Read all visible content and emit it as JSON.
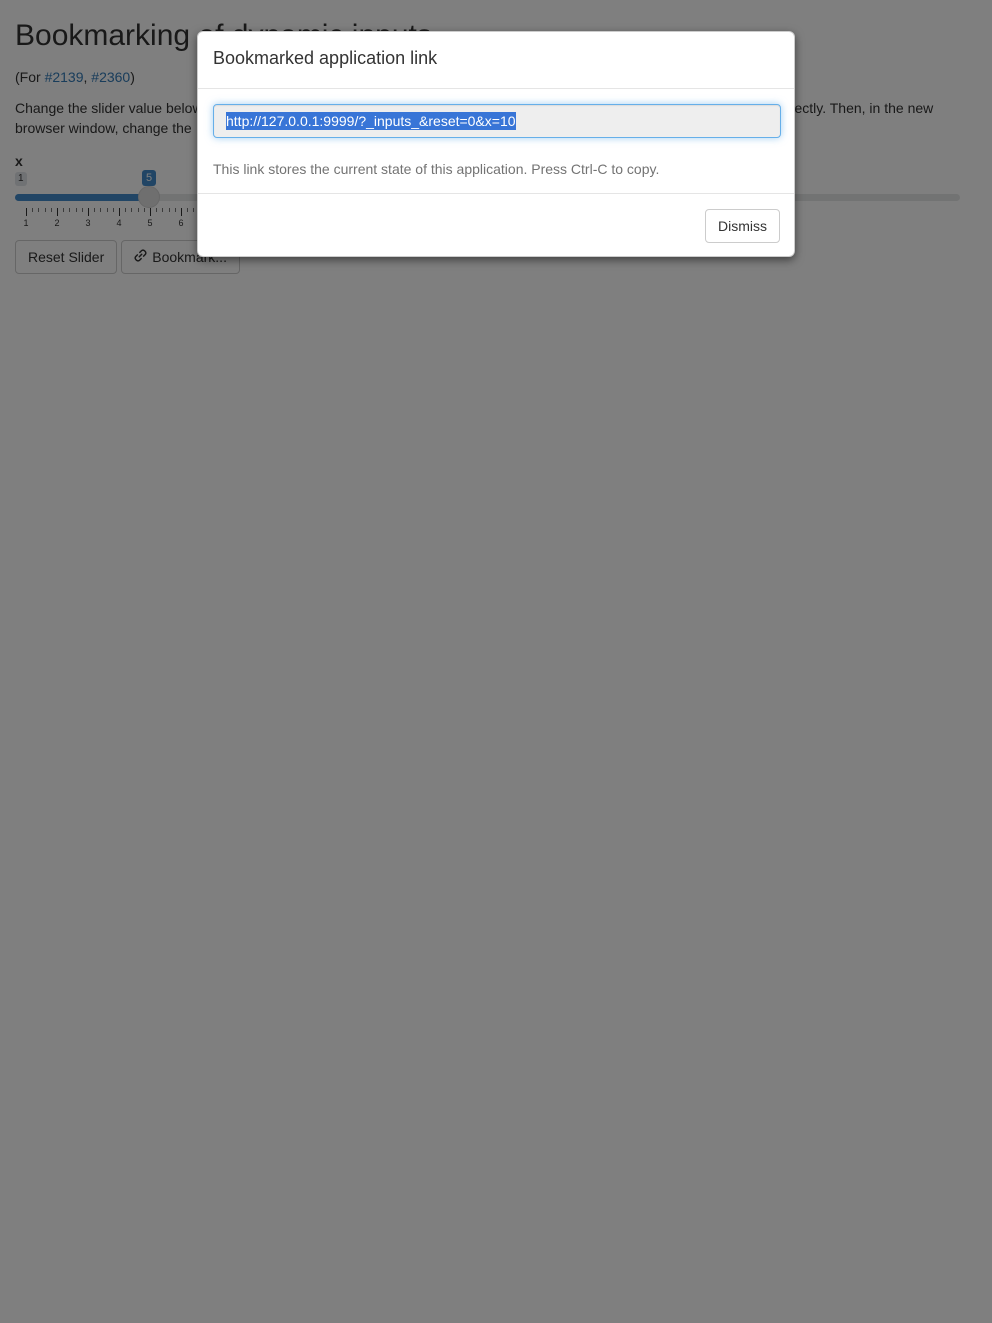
{
  "page": {
    "title": "Bookmarking of dynamic inputs",
    "refs_prefix": "(For ",
    "refs": [
      "#2139",
      "#2360"
    ],
    "refs_sep": ", ",
    "refs_suffix": ")",
    "desc_visible_left": "Change the slider value below",
    "desc_visible_right": "correctly. Then, in the new",
    "desc_line2": "browser window, change the"
  },
  "slider": {
    "label": "x",
    "min_label": "1",
    "value": 5,
    "value_label": "5",
    "tick_labels": [
      "1",
      "2",
      "3",
      "4",
      "5",
      "6"
    ]
  },
  "buttons": {
    "reset": "Reset Slider",
    "bookmark": "Bookmark..."
  },
  "modal": {
    "title": "Bookmarked application link",
    "url": "http://127.0.0.1:9999/?_inputs_&reset=0&x=10",
    "help": "This link stores the current state of this application. Press Ctrl-C to copy.",
    "dismiss": "Dismiss"
  },
  "icons": {
    "bookmark": "link-icon"
  },
  "colors": {
    "accent": "#428bca",
    "link": "#337ab7",
    "selection": "#3875d7",
    "overlay": "rgba(0,0,0,0.5)"
  }
}
